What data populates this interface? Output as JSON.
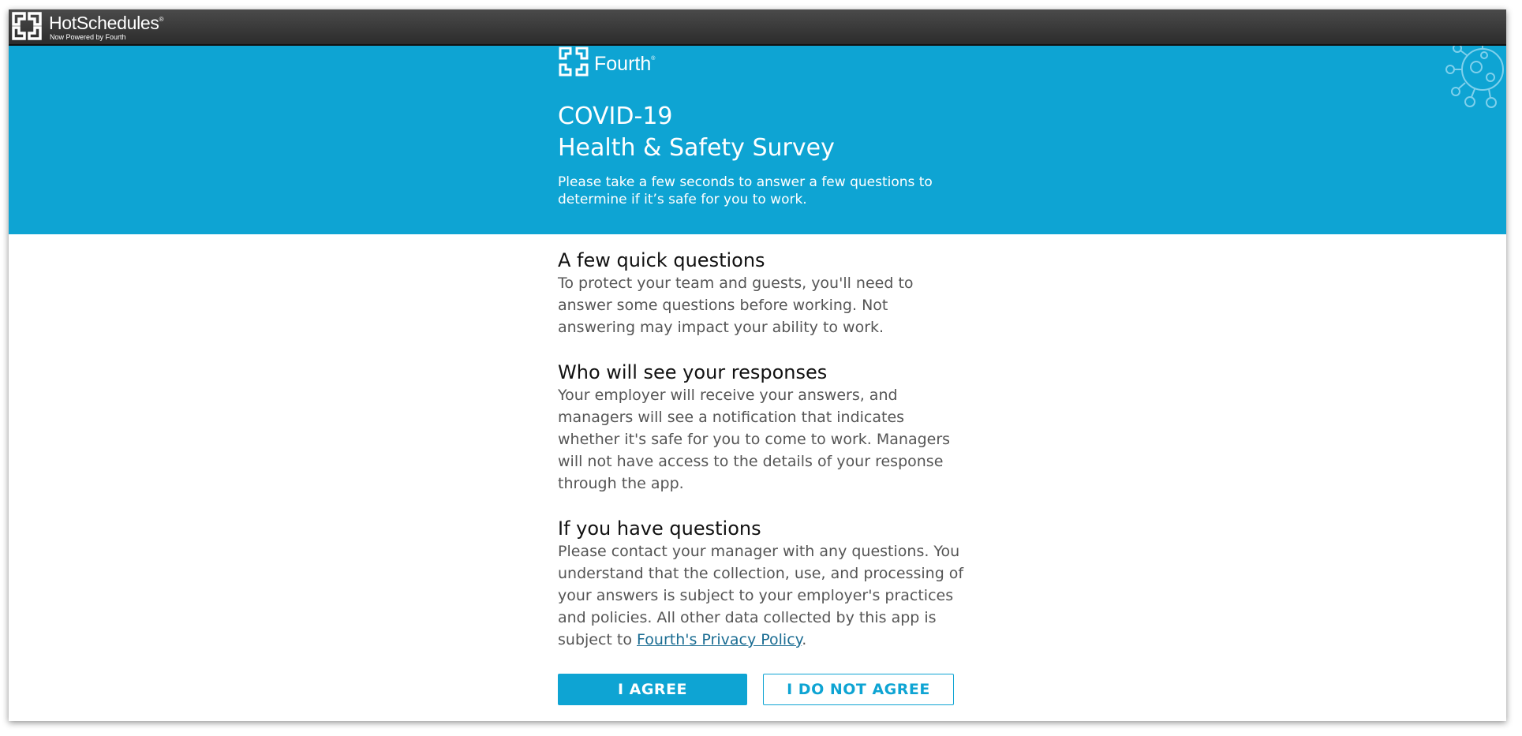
{
  "header": {
    "brand": "HotSchedules",
    "brand_sub": "Now Powered by Fourth"
  },
  "hero": {
    "logo_text": "Fourth",
    "title_line1": "COVID-19",
    "title_line2": "Health & Safety Survey",
    "intro": "Please take a few seconds to answer a few questions to determine if it’s safe for you to work."
  },
  "sections": [
    {
      "title": "A few quick questions",
      "body": "To protect your team and guests, you'll need to answer some questions before working. Not answering may impact your ability to work."
    },
    {
      "title": "Who will see your responses",
      "body": "Your employer will receive your answers, and managers will see a notification that indicates whether it's safe for you to come to work. Managers will not have access to the details of your response through the app."
    },
    {
      "title": "If you have questions",
      "body": "Please contact your manager with any questions. You understand that the collection, use, and processing of your answers is subject to your employer's practices and policies. All other data collected by this app is subject to ",
      "link_text": "Fourth's Privacy Policy",
      "body_end": "."
    }
  ],
  "buttons": {
    "agree": "I AGREE",
    "disagree": "I DO NOT AGREE"
  },
  "colors": {
    "accent": "#0ea4d3",
    "topbar": "#333333",
    "link": "#1a6c92"
  }
}
